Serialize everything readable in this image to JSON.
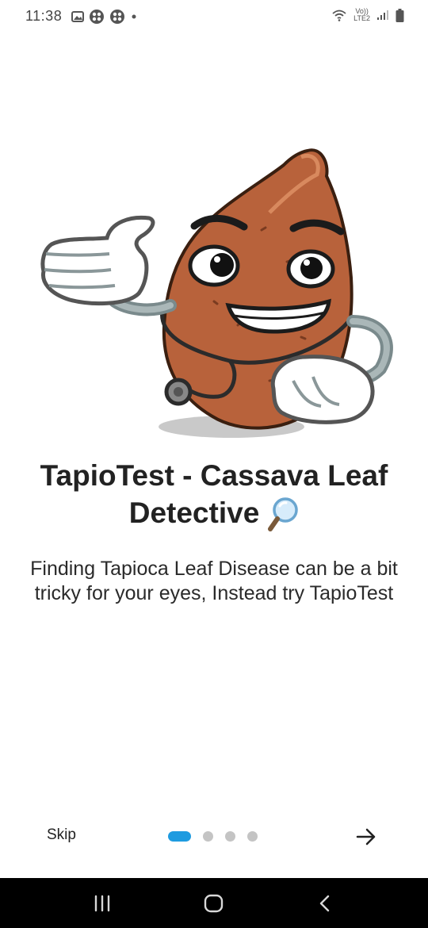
{
  "status_bar": {
    "time": "11:38",
    "left_icons": [
      "image-icon",
      "app-icon",
      "app-icon",
      "dot-icon"
    ],
    "network_label_top": "Vo))",
    "network_label_bottom": "LTE2",
    "right_icons": [
      "wifi-icon",
      "signal-icon",
      "battery-icon"
    ]
  },
  "onboarding": {
    "illustration": "cassava-doctor-mascot",
    "title": "TapioTest - Cassava Leaf Detective",
    "title_icon": "magnifying-glass-icon",
    "subtitle": "Finding Tapioca Leaf Disease can be a bit tricky for your eyes, Instead try TapioTest"
  },
  "bottom_nav": {
    "skip_label": "Skip",
    "page_count": 4,
    "current_page": 1,
    "next_icon": "arrow-right-icon",
    "accent_color": "#1e9be0",
    "inactive_dot_color": "#c4c4c4"
  },
  "system_nav": {
    "buttons": [
      "recent-apps-icon",
      "home-icon",
      "back-icon"
    ]
  }
}
